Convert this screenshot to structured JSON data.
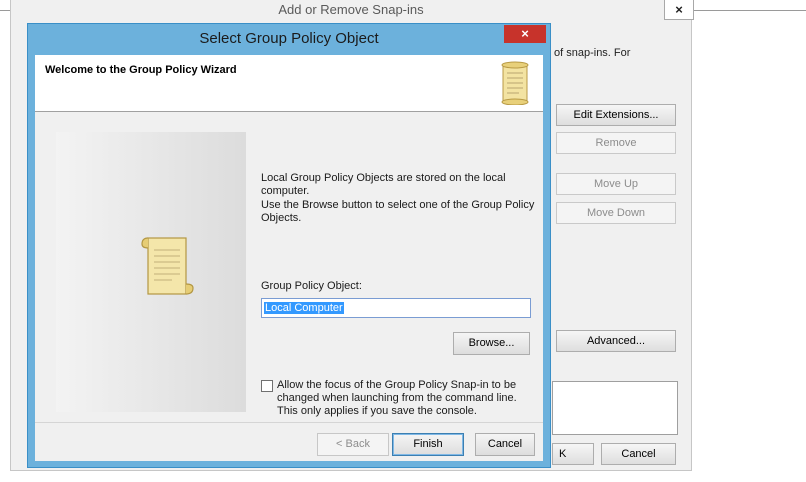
{
  "background_dialog": {
    "title": "Add or Remove Snap-ins",
    "close_glyph": "×",
    "snippet_text": "of snap-ins. For",
    "buttons": {
      "edit_extensions": "Edit Extensions...",
      "remove": "Remove",
      "move_up": "Move Up",
      "move_down": "Move Down",
      "advanced": "Advanced...",
      "ok_partial": "K",
      "cancel": "Cancel"
    }
  },
  "wizard": {
    "title": "Select Group Policy Object",
    "close_glyph": "×",
    "heading": "Welcome to the Group Policy Wizard",
    "body": {
      "line1": "Local Group Policy Objects are stored on the local computer.",
      "line2": "Use the Browse button to select one of the Group Policy Objects.",
      "gpo_label": "Group Policy Object:",
      "gpo_value": "Local Computer",
      "browse_label": "Browse...",
      "checkbox_label": "Allow the focus of the Group Policy Snap-in to be changed when launching from the command line.  This only applies if you save the console.",
      "checkbox_checked": false
    },
    "footer": {
      "back_label": "< Back",
      "finish_label": "Finish",
      "cancel_label": "Cancel"
    }
  },
  "colors": {
    "title_bar": "#6cb1dc",
    "close_button": "#c7332b",
    "selection": "#3399ff"
  },
  "icons": {
    "header_icon": "scroll-icon",
    "panel_icon": "scroll-icon"
  }
}
